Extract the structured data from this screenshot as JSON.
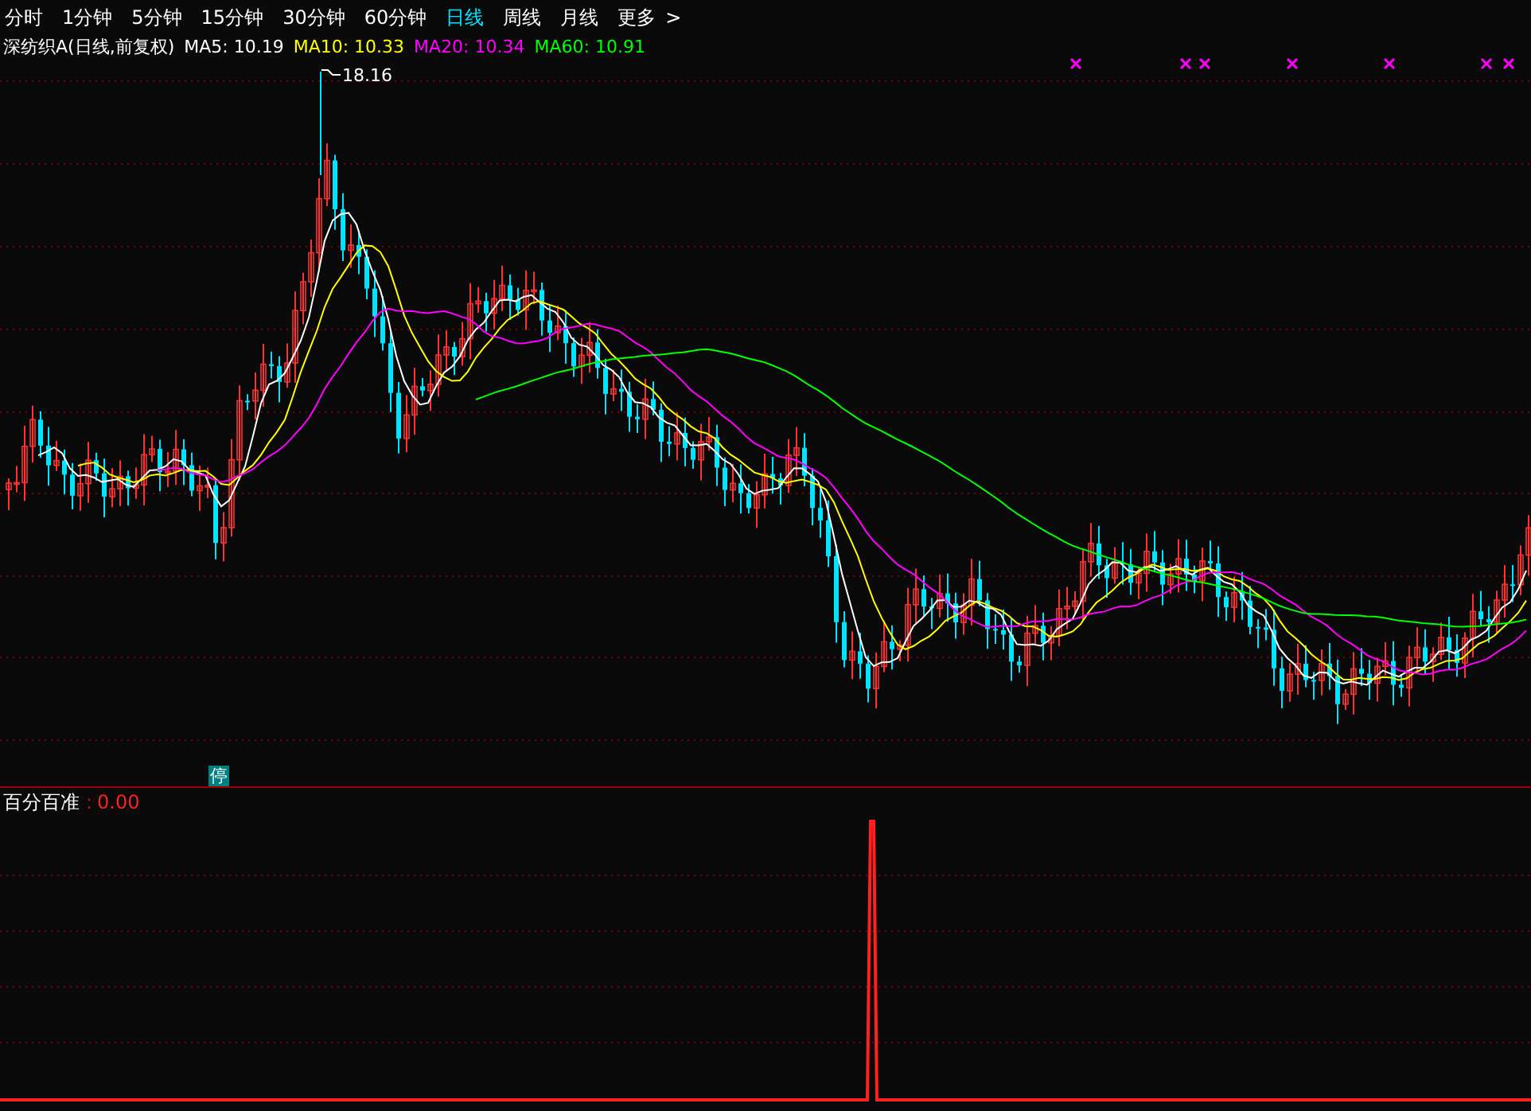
{
  "tabs": [
    {
      "label": "分时",
      "selected": false
    },
    {
      "label": "1分钟",
      "selected": false
    },
    {
      "label": "5分钟",
      "selected": false
    },
    {
      "label": "15分钟",
      "selected": false
    },
    {
      "label": "30分钟",
      "selected": false
    },
    {
      "label": "60分钟",
      "selected": false
    },
    {
      "label": "日线",
      "selected": true
    },
    {
      "label": "周线",
      "selected": false
    },
    {
      "label": "月线",
      "selected": false
    }
  ],
  "more": {
    "label": "更多",
    "arrow": ">"
  },
  "chart": {
    "title": "深纺织A(日线,前复权)",
    "legend": [
      {
        "label": "MA5: 10.19",
        "color": "#ffffff"
      },
      {
        "label": "MA10: 10.33",
        "color": "#ffff00"
      },
      {
        "label": "MA20: 10.34",
        "color": "#ff00ff"
      },
      {
        "label": "MA60: 10.91",
        "color": "#00ff00"
      }
    ],
    "high_marker": "18.16",
    "stop_badge": "停"
  },
  "indicator": {
    "name": "百分百准",
    "separator": ":",
    "value": "0.00"
  }
}
